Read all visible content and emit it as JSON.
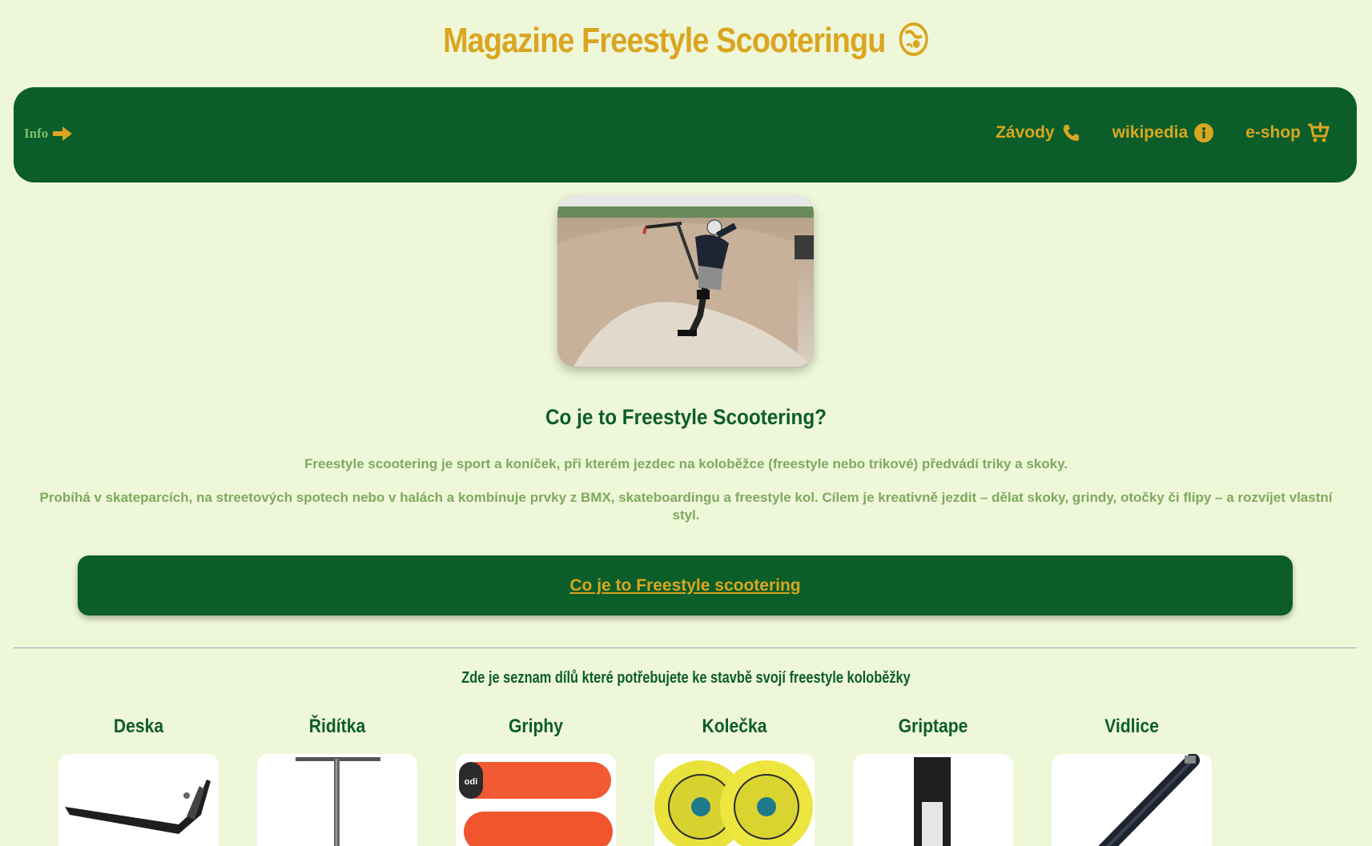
{
  "header": {
    "title": "Magazine Freestyle Scooteringu",
    "logo_icon": "globe-skater-icon"
  },
  "nav": {
    "info_label": "Info",
    "info_icon": "arrow-right-icon",
    "links": [
      {
        "label": "Závody",
        "icon": "phone-icon"
      },
      {
        "label": "wikipedia",
        "icon": "info-circle-icon"
      },
      {
        "label": "e-shop",
        "icon": "cart-plus-icon"
      }
    ]
  },
  "hero": {
    "image_icon": "scooter-rider-photo"
  },
  "intro": {
    "heading": "Co je to Freestyle Scootering?",
    "paragraph1": "Freestyle scootering je sport a koníček, při kterém jezdec na koloběžce (freestyle nebo trikové) předvádí triky a skoky.",
    "paragraph2": "Probíhá v skateparcích, na streetových spotech nebo v halách a kombinuje prvky z BMX, skateboardingu a freestyle kol. Cílem je kreativně jezdit – dělat skoky, grindy, otočky či flipy – a rozvíjet vlastní styl."
  },
  "cta": {
    "label": "Co je to Freestyle scootering"
  },
  "parts": {
    "heading": "Zde je seznam dílů které potřebujete ke stavbě svojí freestyle koloběžky",
    "items": [
      {
        "name": "Deska",
        "image": "deck-photo"
      },
      {
        "name": "Řidítka",
        "image": "handlebar-photo"
      },
      {
        "name": "Griphy",
        "image": "grips-photo"
      },
      {
        "name": "Kolečka",
        "image": "wheels-photo"
      },
      {
        "name": "Griptape",
        "image": "griptape-photo"
      },
      {
        "name": "Vidlice",
        "image": "fork-photo"
      }
    ]
  },
  "colors": {
    "background": "#eff7d9",
    "primary_green": "#0b5e29",
    "accent_gold": "#daa520",
    "text_light_green": "#7fa95f"
  }
}
